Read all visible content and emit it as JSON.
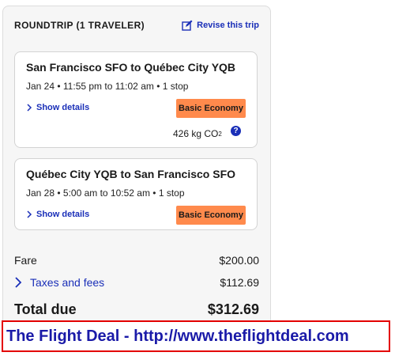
{
  "header": {
    "title": "ROUNDTRIP (1 TRAVELER)",
    "revise_label": "Revise this trip"
  },
  "flights": [
    {
      "route": "San Francisco SFO to Québec City YQB",
      "times": "Jan 24 • 11:55 pm to 11:02 am • 1 stop",
      "details_label": "Show details",
      "fare_class": "Basic Economy",
      "co2_value": "426 kg CO",
      "co2_sub": "2",
      "help_label": "?"
    },
    {
      "route": "Québec City YQB to San Francisco SFO",
      "times": "Jan 28 • 5:00 am to 10:52 am • 1 stop",
      "details_label": "Show details",
      "fare_class": "Basic Economy"
    }
  ],
  "summary": {
    "fare_label": "Fare",
    "fare_value": "$200.00",
    "taxes_label": "Taxes and fees",
    "taxes_value": "$112.69",
    "total_label": "Total due",
    "total_value": "$312.69"
  },
  "footer": {
    "text": "The Flight Deal - http://www.theflightdeal.com"
  },
  "colors": {
    "accent": "#1a2fb8",
    "badge": "#ff8a4c",
    "footer_border": "#e30000",
    "footer_text": "#1a1aa8"
  }
}
